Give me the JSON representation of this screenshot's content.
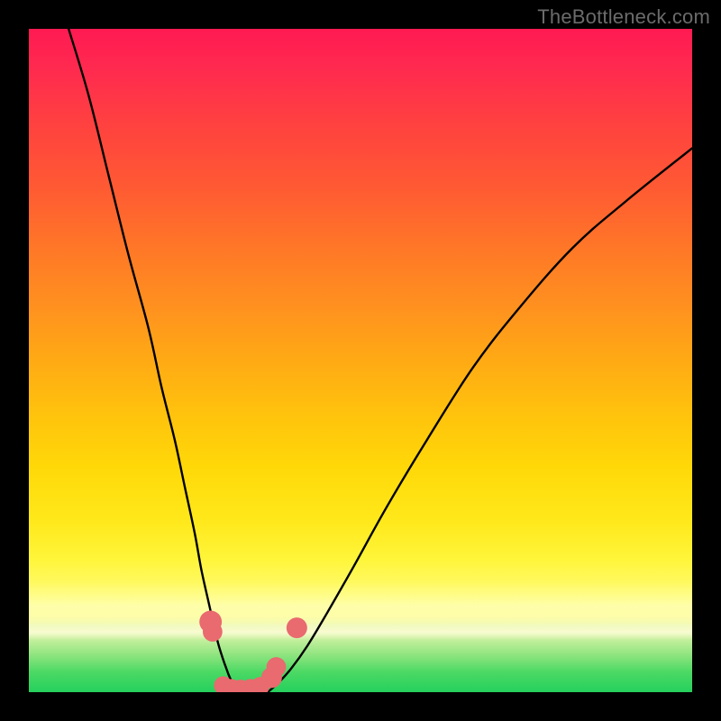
{
  "watermark": "TheBottleneck.com",
  "chart_data": {
    "type": "line",
    "title": "",
    "xlabel": "",
    "ylabel": "",
    "xlim": [
      0,
      100
    ],
    "ylim": [
      0,
      100
    ],
    "background_gradient": {
      "top": "#ff1a52",
      "upper_mid": "#ffaa14",
      "lower_mid": "#fff53a",
      "bottom": "#25d05d"
    },
    "series": [
      {
        "name": "left-curve",
        "x": [
          6,
          9,
          12,
          15,
          18,
          20,
          22,
          23.5,
          25,
          26,
          27,
          27.8,
          28.5,
          29.2,
          29.8,
          30.3,
          31,
          32
        ],
        "y": [
          100,
          90,
          78,
          66,
          55,
          46,
          38,
          31,
          24,
          18.5,
          14,
          10.5,
          7.5,
          5.2,
          3.5,
          2.2,
          1,
          0
        ]
      },
      {
        "name": "right-curve",
        "x": [
          36,
          37.5,
          39.5,
          42,
          45,
          49,
          54,
          60,
          67,
          74,
          82,
          90,
          100
        ],
        "y": [
          0,
          1.3,
          3.5,
          7,
          12,
          19,
          28,
          38,
          49,
          58,
          67,
          74,
          82
        ]
      }
    ],
    "markers": [
      {
        "name": "left-cluster-top",
        "x": 27.4,
        "y": 10.6,
        "r": 1.35
      },
      {
        "name": "left-cluster-mid",
        "x": 27.7,
        "y": 9.1,
        "r": 1.1
      },
      {
        "name": "bottom-1",
        "x": 29.3,
        "y": 1.0,
        "r": 1.0
      },
      {
        "name": "bottom-2",
        "x": 30.5,
        "y": 0.6,
        "r": 1.0
      },
      {
        "name": "bottom-3",
        "x": 31.9,
        "y": 0.5,
        "r": 1.0
      },
      {
        "name": "bottom-4",
        "x": 33.4,
        "y": 0.6,
        "r": 1.0
      },
      {
        "name": "bottom-5",
        "x": 34.9,
        "y": 0.9,
        "r": 1.0
      },
      {
        "name": "right-cluster-low",
        "x": 36.6,
        "y": 2.2,
        "r": 1.2
      },
      {
        "name": "right-cluster-high",
        "x": 37.3,
        "y": 3.8,
        "r": 1.1
      },
      {
        "name": "right-outlier",
        "x": 40.4,
        "y": 9.7,
        "r": 1.2
      }
    ],
    "marker_color": "#e96a6f"
  }
}
